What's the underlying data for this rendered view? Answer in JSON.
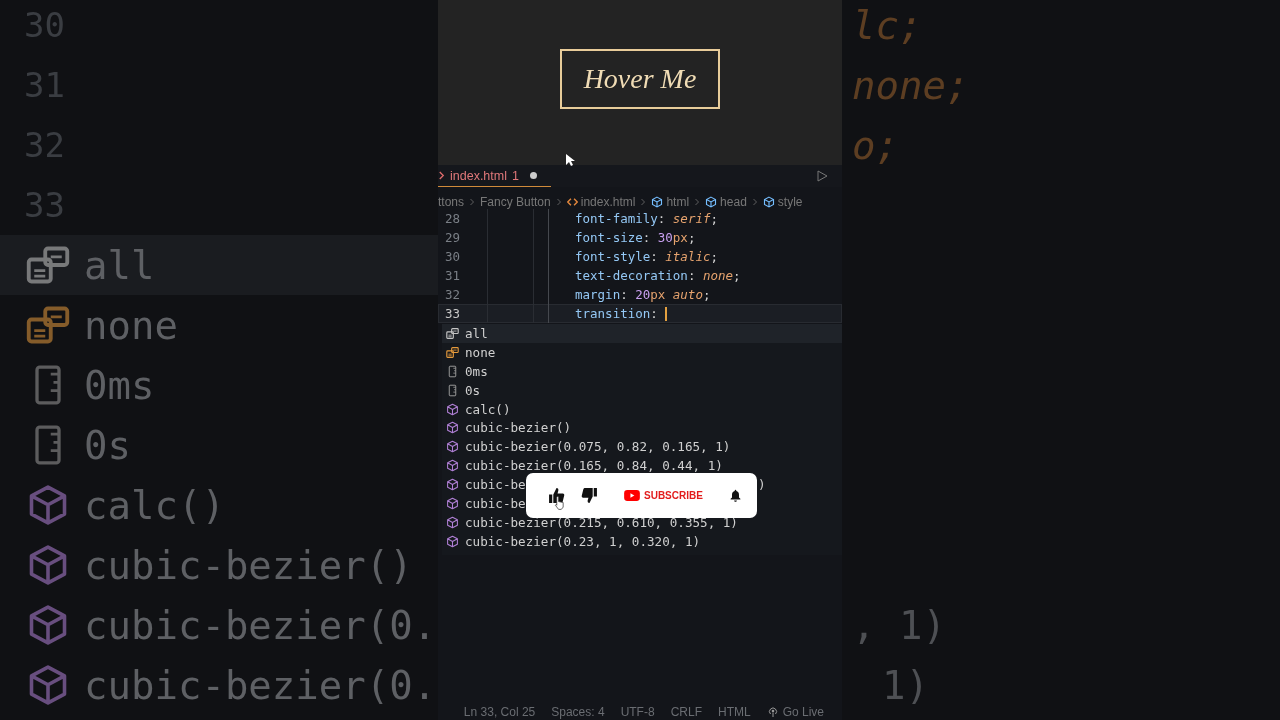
{
  "backdrop": {
    "line_numbers": [
      "30",
      "31",
      "32",
      "33"
    ],
    "items": [
      {
        "kind": "enum",
        "text": "all",
        "selected": true
      },
      {
        "kind": "enum2",
        "text": "none",
        "selected": false
      },
      {
        "kind": "unit",
        "text": "0ms",
        "selected": false
      },
      {
        "kind": "unit",
        "text": "0s",
        "selected": false
      },
      {
        "kind": "function",
        "text": "calc()",
        "selected": false
      },
      {
        "kind": "function",
        "text": "cubic-bezier()",
        "selected": false
      },
      {
        "kind": "function",
        "text": "cubic-bezier(0.",
        "selected": false
      },
      {
        "kind": "function",
        "text": "cubic-bezier(0.",
        "selected": false
      }
    ],
    "right_top": [
      "lc;",
      "none;",
      "o;"
    ],
    "right_bottom": [
      ", 1)",
      "1)"
    ]
  },
  "preview": {
    "button_label": "Hover Me"
  },
  "tab": {
    "label": "index.html",
    "problems": "1",
    "modified": true
  },
  "breadcrumbs": [
    {
      "kind": "folder",
      "text": "ttons"
    },
    {
      "kind": "folder",
      "text": "Fancy Button"
    },
    {
      "kind": "file",
      "text": "index.html"
    },
    {
      "kind": "element",
      "text": "html"
    },
    {
      "kind": "element",
      "text": "head"
    },
    {
      "kind": "element",
      "text": "style"
    }
  ],
  "code": [
    {
      "number": "28",
      "current": false,
      "tokens": [
        {
          "kind": "prop",
          "text": "font-family"
        },
        {
          "kind": "punct",
          "text": ":"
        },
        {
          "kind": "value",
          "text": "serif"
        },
        {
          "kind": "punct",
          "text": ";"
        }
      ]
    },
    {
      "number": "29",
      "current": false,
      "tokens": [
        {
          "kind": "prop",
          "text": "font-size"
        },
        {
          "kind": "punct",
          "text": ":"
        },
        {
          "kind": "num",
          "text": "30"
        },
        {
          "kind": "unit",
          "text": "px"
        },
        {
          "kind": "punct",
          "text": ";"
        }
      ]
    },
    {
      "number": "30",
      "current": false,
      "tokens": [
        {
          "kind": "prop",
          "text": "font-style"
        },
        {
          "kind": "punct",
          "text": ":"
        },
        {
          "kind": "value",
          "text": "italic"
        },
        {
          "kind": "punct",
          "text": ";"
        }
      ]
    },
    {
      "number": "31",
      "current": false,
      "tokens": [
        {
          "kind": "prop",
          "text": "text-decoration"
        },
        {
          "kind": "punct",
          "text": ":"
        },
        {
          "kind": "value",
          "text": "none"
        },
        {
          "kind": "punct",
          "text": ";"
        }
      ]
    },
    {
      "number": "32",
      "current": false,
      "tokens": [
        {
          "kind": "prop",
          "text": "margin"
        },
        {
          "kind": "punct",
          "text": ":"
        },
        {
          "kind": "num",
          "text": "20"
        },
        {
          "kind": "unit",
          "text": "px"
        },
        {
          "kind": "value",
          "text": "auto"
        },
        {
          "kind": "punct",
          "text": ";"
        }
      ]
    },
    {
      "number": "33",
      "current": true,
      "tokens": [
        {
          "kind": "prop",
          "text": "transition"
        },
        {
          "kind": "punct",
          "text": ":"
        },
        {
          "kind": "caret"
        }
      ]
    }
  ],
  "suggestions": [
    {
      "kind": "enum",
      "text": "all",
      "selected": true
    },
    {
      "kind": "enum2",
      "text": "none",
      "selected": false
    },
    {
      "kind": "unit",
      "text": "0ms",
      "selected": false
    },
    {
      "kind": "unit",
      "text": "0s",
      "selected": false
    },
    {
      "kind": "function",
      "text": "calc()",
      "selected": false
    },
    {
      "kind": "function",
      "text": "cubic-bezier()",
      "selected": false
    },
    {
      "kind": "function",
      "text": "cubic-bezier(0.075, 0.82, 0.165, 1)",
      "selected": false
    },
    {
      "kind": "function",
      "text": "cubic-bezier(0.165, 0.84, 0.44, 1)",
      "selected": false
    },
    {
      "kind": "function",
      "text": "cubic-be",
      "tail": ")",
      "selected": false
    },
    {
      "kind": "function",
      "text": "cubic-be",
      "selected": false
    },
    {
      "kind": "function",
      "text": "cubic-bezier(0.215, 0.610, 0.355, 1)",
      "selected": false
    },
    {
      "kind": "function",
      "text": "cubic-bezier(0.23, 1, 0.320, 1)",
      "selected": false
    }
  ],
  "overlay": {
    "subscribe_label": "SUBSCRIBE"
  },
  "status_bar": [
    {
      "kind": "text",
      "text": "Ln 33, Col 25"
    },
    {
      "kind": "text",
      "text": "Spaces: 4"
    },
    {
      "kind": "text",
      "text": "UTF-8"
    },
    {
      "kind": "text",
      "text": "CRLF"
    },
    {
      "kind": "text",
      "text": "HTML"
    },
    {
      "kind": "live",
      "text": "Go Live"
    }
  ]
}
